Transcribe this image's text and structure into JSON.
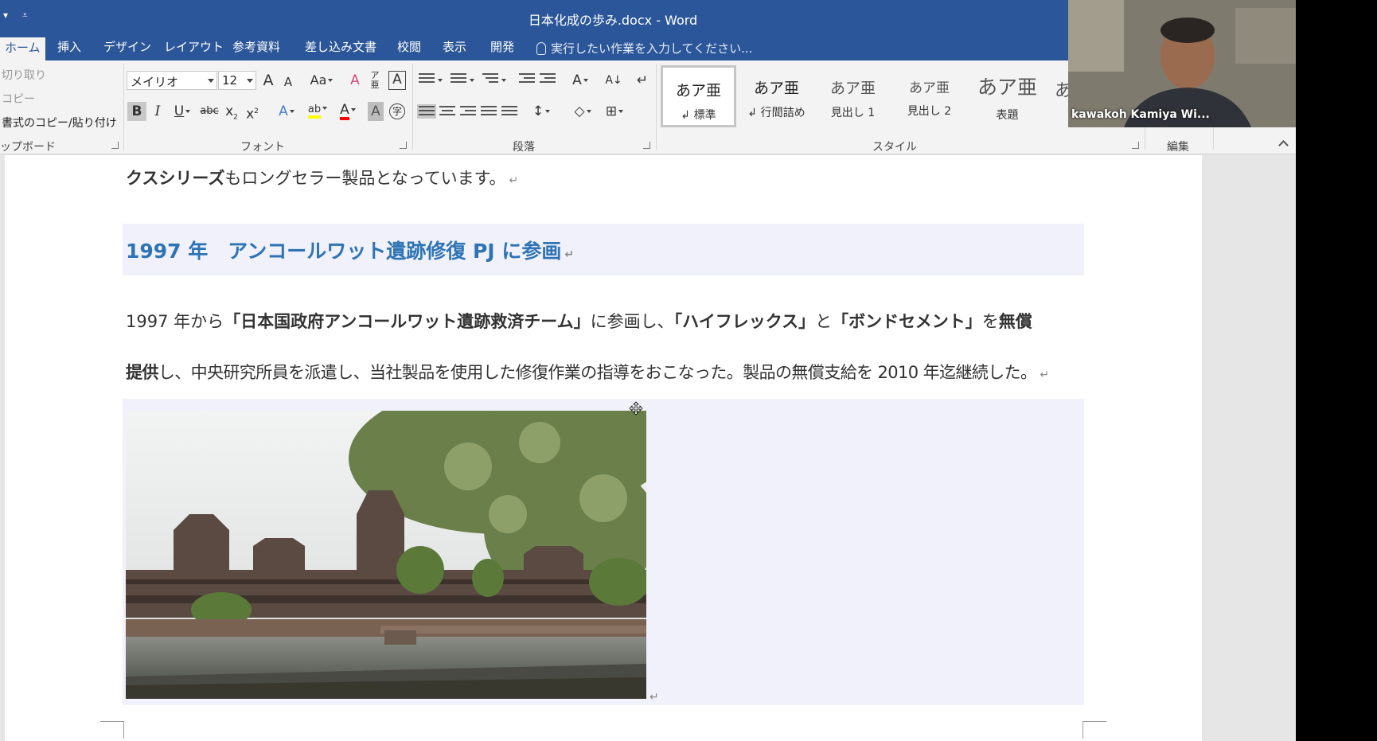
{
  "window": {
    "title": "日本化成の歩み.docx - Word",
    "qat_icons": [
      "quick-access-dropdown-icon",
      "customize-qat-icon"
    ]
  },
  "ribbon_tabs": [
    {
      "label": "ホーム",
      "active": true
    },
    {
      "label": "挿入"
    },
    {
      "label": "デザイン"
    },
    {
      "label": "レイアウト"
    },
    {
      "label": "参考資料"
    },
    {
      "label": "差し込み文書"
    },
    {
      "label": "校閲"
    },
    {
      "label": "表示"
    },
    {
      "label": "開発"
    }
  ],
  "tell_me": {
    "placeholder": "実行したい作業を入力してください..."
  },
  "clipboard": {
    "cut": "切り取り",
    "copy": "コピー",
    "format_painter": "書式のコピー/貼り付け",
    "label": "ップボード"
  },
  "font": {
    "name": "メイリオ",
    "size": "12",
    "label": "フォント",
    "grow": "A",
    "shrink": "A",
    "case": "Aa",
    "bold": "B",
    "italic": "I",
    "underline": "U",
    "strike": "abc",
    "sub": "x",
    "sup": "x",
    "sub_mark": "2",
    "sup_mark": "2",
    "highlight": "ab",
    "color": "A",
    "shade": "A",
    "effects": "A",
    "enclose": "字",
    "clear": "A",
    "border": "A",
    "colors": {
      "highlight": "#ffff00",
      "font": "#ff0000"
    }
  },
  "paragraph": {
    "label": "段落",
    "sort": "A↓",
    "dir": "A"
  },
  "styles": {
    "label": "スタイル",
    "items": [
      {
        "sample": "あア亜",
        "name": "↲ 標準",
        "active": true
      },
      {
        "sample": "あア亜",
        "name": "↲ 行間詰め"
      },
      {
        "sample": "あア亜",
        "name": "見出し 1"
      },
      {
        "sample": "あア亜",
        "name": "見出し 2"
      },
      {
        "sample": "あア亜",
        "name": "表題"
      },
      {
        "sample": "あ",
        "name": ""
      }
    ]
  },
  "editing": {
    "label": "編集"
  },
  "document": {
    "line1_bold": "クスシリーズ",
    "line1_rest": "もロングセラー製品となっています。",
    "heading": "1997 年　アンコールワット遺跡修復 PJ に参画",
    "p2_a": "1997 年から",
    "p2_b": "「日本国政府アンコールワット遺跡救済チーム」",
    "p2_c": "に参画し、",
    "p2_d": "「ハイフレックス」",
    "p2_e": "と",
    "p2_f": "「ボンドセメント」",
    "p2_g": "を",
    "p2_h": "無償",
    "p3_a": "提供",
    "p3_b": "し、中央研究所員を派遣し、当社製品を使用した修復作業の指導をおこなった。製品の無償支給を 2010 年迄継続した。",
    "paragraph_mark": "↵",
    "colors": {
      "heading": "#2e74b5",
      "shading": "#f1f1fb"
    }
  },
  "video": {
    "participant": "kawakoh Kamiya  Wi..."
  }
}
